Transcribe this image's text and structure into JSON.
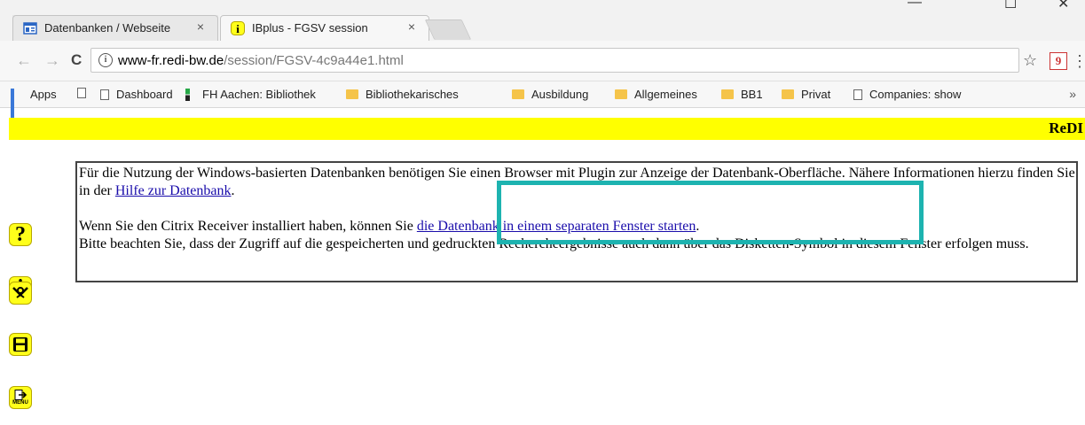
{
  "tabs": [
    {
      "label": "Datenbanken / Webseite",
      "close": "×",
      "active": false
    },
    {
      "label": "IBplus - FGSV session",
      "close": "×",
      "active": true
    }
  ],
  "window_controls": {
    "minimize": "—",
    "maximize": "☐",
    "close": "✕"
  },
  "toolbar": {
    "back": "←",
    "forward": "→",
    "reload": "C",
    "info": "i",
    "url_host": "www-fr.redi-bw.de",
    "url_path": "/session/FGSV-4c9a44e1.html",
    "star": "☆",
    "extension": "9",
    "menu": "⋮"
  },
  "bookmarks": {
    "items": [
      {
        "label": "Apps",
        "icon": "apps-grid-icon"
      },
      {
        "label": "",
        "icon": "page-icon"
      },
      {
        "label": "Dashboard",
        "icon": "page-icon"
      },
      {
        "label": "FH Aachen: Bibliothek",
        "icon": "fh-aachen-icon"
      },
      {
        "label": "Bibliothekarisches",
        "icon": "folder-icon"
      },
      {
        "label": "Ausbildung",
        "icon": "folder-icon"
      },
      {
        "label": "Allgemeines",
        "icon": "folder-icon"
      },
      {
        "label": "BB1",
        "icon": "folder-icon"
      },
      {
        "label": "Privat",
        "icon": "folder-icon"
      },
      {
        "label": "Companies: show",
        "icon": "page-icon"
      }
    ],
    "more": "»"
  },
  "page": {
    "brand": "ReDI",
    "side_icons": [
      "help-icon",
      "info-icon",
      "post-horn-icon",
      "save-disk-icon",
      "menu-icon"
    ],
    "help_glyph": "?",
    "info_glyph": "i",
    "menu_glyph": "MENU",
    "message": {
      "p1_text": "Für die Nutzung der Windows-basierten Datenbanken benötigen Sie einen Browser mit Plugin zur Anzeige der Datenbank-Oberfläche. Nähere Informationen hierzu finden Sie in der ",
      "p1_link": "Hilfe zur Datenbank",
      "p1_end": ".",
      "p2_text": "Wenn Sie den Citrix Receiver installiert haben, können Sie ",
      "p2_link": "die Datenbank in einem separaten Fenster starten",
      "p2_end": ".",
      "p3_text": "Bitte beachten Sie, dass der Zugriff auf die gespeicherten und gedruckten Rechercheergebnisse auch dann über das Disketten-Symbol in diesem Fenster erfolgen muss."
    },
    "highlight_color": "#1db3b0",
    "bar_color": "#ffff00"
  }
}
